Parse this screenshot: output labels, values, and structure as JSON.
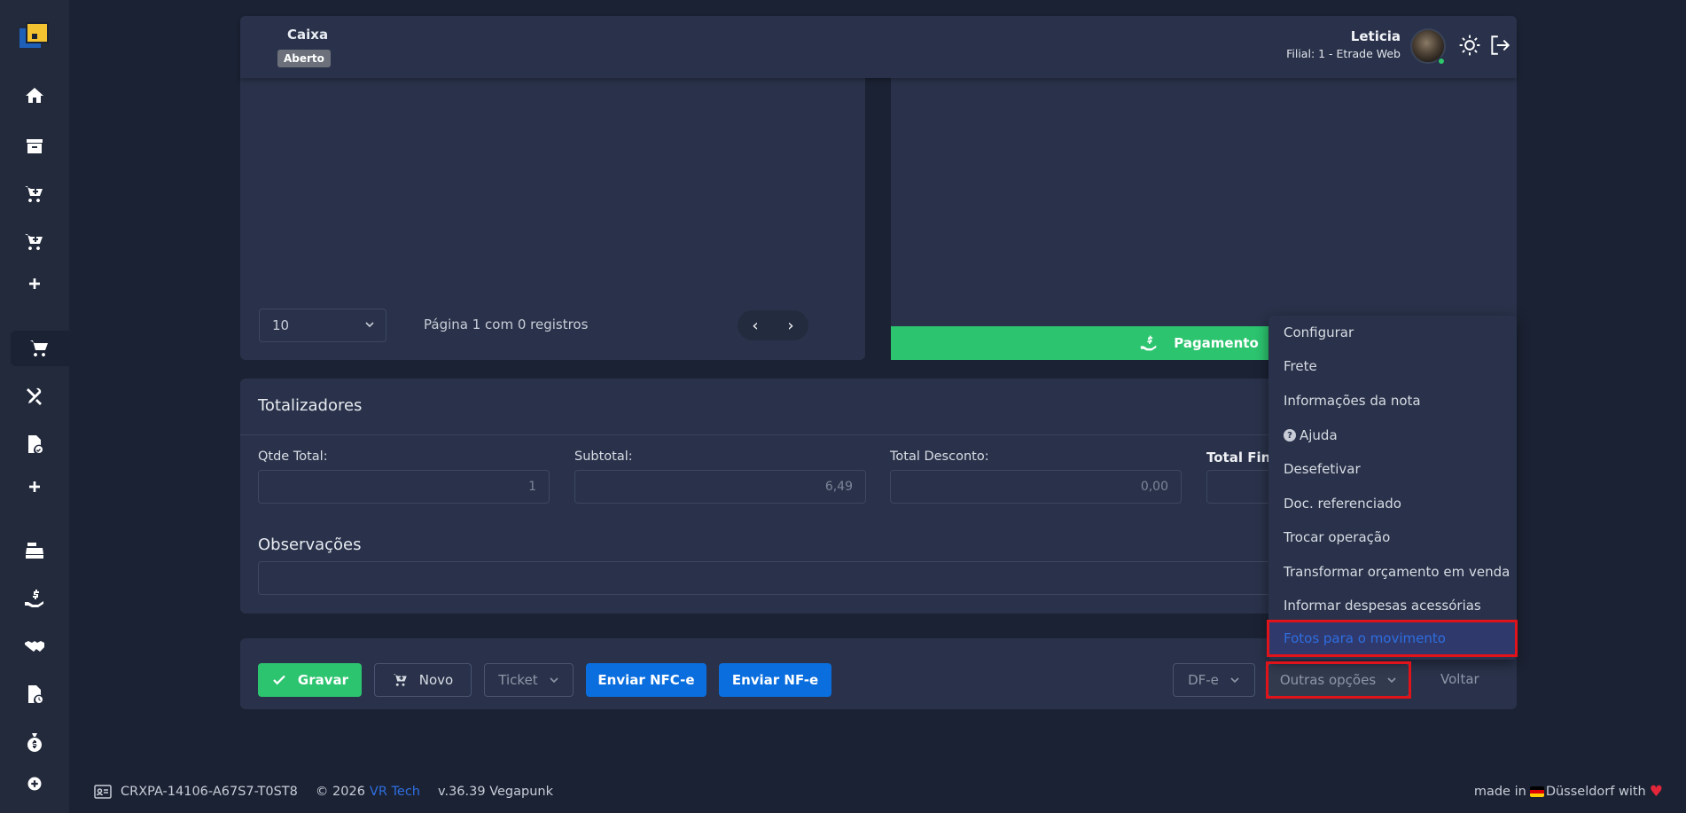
{
  "header": {
    "caixa_label": "Caixa",
    "caixa_status": "Aberto",
    "user_name": "Leticia",
    "user_branch": "Filial: 1 - Etrade Web"
  },
  "list": {
    "page_size": "10",
    "page_info": "Página 1 com 0 registros",
    "prev": "‹",
    "next": "›"
  },
  "payment_button": "Pagamento",
  "totals": {
    "title": "Totalizadores",
    "qtde_label": "Qtde Total:",
    "qtde_value": "1",
    "subtotal_label": "Subtotal:",
    "subtotal_value": "6,49",
    "desconto_label": "Total Desconto:",
    "desconto_value": "0,00",
    "final_label": "Total Fina"
  },
  "observacoes": {
    "title": "Observações"
  },
  "actions": {
    "gravar": "Gravar",
    "novo": "Novo",
    "ticket": "Ticket",
    "enviar_nfce": "Enviar NFC-e",
    "enviar_nfe": "Enviar NF-e",
    "dfe": "DF-e",
    "outras_opcoes": "Outras opções",
    "voltar": "Voltar"
  },
  "menu": {
    "items": [
      "Configurar",
      "Frete",
      "Informações da nota",
      "Ajuda",
      "Desefetivar",
      "Doc. referenciado",
      "Trocar operação",
      "Transformar orçamento em venda",
      "Informar despesas acessórias",
      "Fotos para o movimento"
    ],
    "highlighted_index": 9
  },
  "footer": {
    "device_id": "CRXPA-14106-A67S7-T0ST8",
    "copyright_prefix": "© 2026",
    "brand": "VR Tech",
    "version": "v.36.39 Vegapunk",
    "made_in_prefix": "made in",
    "made_in_city": "Düsseldorf with",
    "heart": "♥"
  },
  "colors": {
    "background": "#1b2233",
    "panel": "#29324a",
    "green": "#2cc46f",
    "blue": "#0a6ede",
    "highlight_red": "#e0131a"
  },
  "icons": {
    "sidebar": [
      "logo-icon",
      "home-icon",
      "archive-icon",
      "cart-plus-icon",
      "cart-plus-icon",
      "plus-icon",
      "cart-icon",
      "tools-icon",
      "document-check-icon",
      "plus-icon",
      "cash-register-icon",
      "hand-dollar-icon",
      "handshake-icon",
      "document-clock-icon",
      "money-bag-icon",
      "plus-circle-icon"
    ]
  }
}
